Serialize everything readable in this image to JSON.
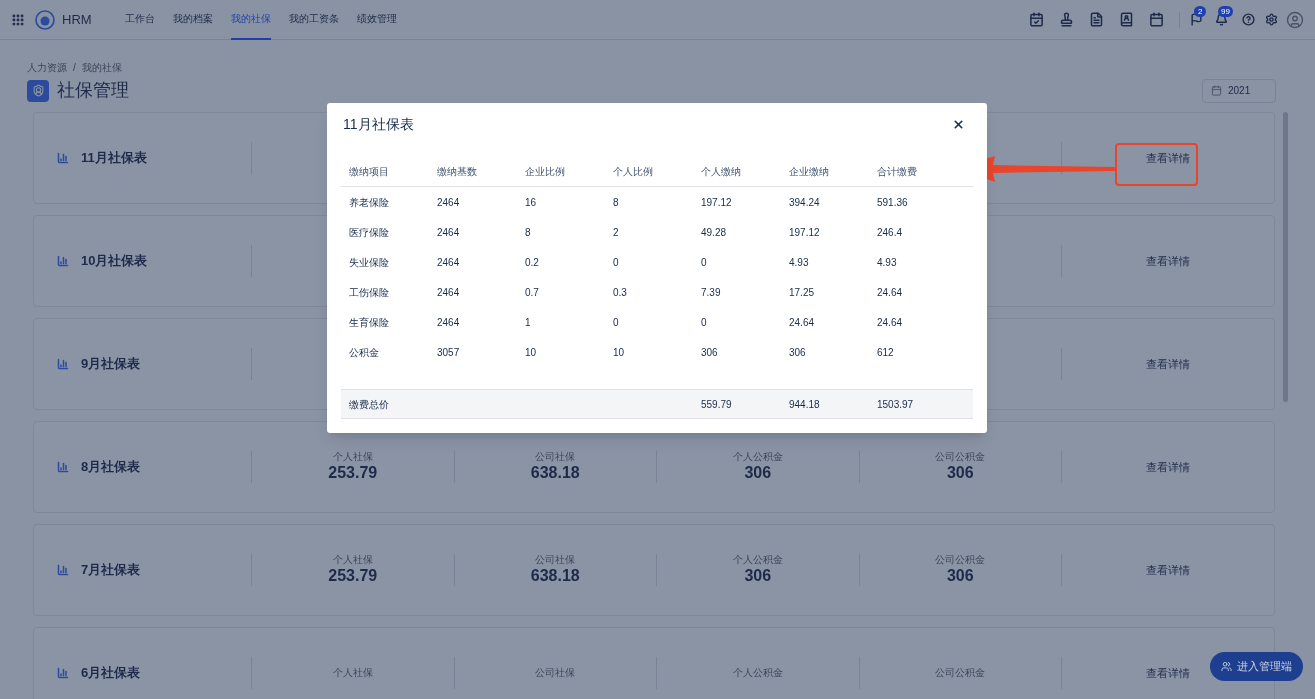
{
  "nav": {
    "app_name": "HRM",
    "tabs": [
      {
        "label": "工作台",
        "selected": false
      },
      {
        "label": "我的档案",
        "selected": false
      },
      {
        "label": "我的社保",
        "selected": true
      },
      {
        "label": "我的工资条",
        "selected": false
      },
      {
        "label": "绩效管理",
        "selected": false
      }
    ],
    "flag_badge": "2",
    "bell_badge": "99"
  },
  "breadcrumb": [
    "人力资源",
    "我的社保"
  ],
  "breadcrumb_separator": "/",
  "page_title": "社保管理",
  "year": "2021",
  "cards": [
    {
      "title": "11月社保表",
      "action": "查看详情"
    },
    {
      "title": "10月社保表",
      "action": "查看详情"
    },
    {
      "title": "9月社保表",
      "action": "查看详情"
    },
    {
      "title": "8月社保表",
      "stats": [
        {
          "label": "个人社保",
          "value": "253.79"
        },
        {
          "label": "公司社保",
          "value": "638.18"
        },
        {
          "label": "个人公积金",
          "value": "306"
        },
        {
          "label": "公司公积金",
          "value": "306"
        }
      ],
      "action": "查看详情"
    },
    {
      "title": "7月社保表",
      "stats": [
        {
          "label": "个人社保",
          "value": "253.79"
        },
        {
          "label": "公司社保",
          "value": "638.18"
        },
        {
          "label": "个人公积金",
          "value": "306"
        },
        {
          "label": "公司公积金",
          "value": "306"
        }
      ],
      "action": "查看详情"
    },
    {
      "title": "6月社保表",
      "stats": [
        {
          "label": "个人社保"
        },
        {
          "label": "公司社保"
        },
        {
          "label": "个人公积金"
        },
        {
          "label": "公司公积金"
        }
      ],
      "action": "查看详情"
    }
  ],
  "modal": {
    "title": "11月社保表",
    "columns": [
      "缴纳项目",
      "缴纳基数",
      "企业比例",
      "个人比例",
      "个人缴纳",
      "企业缴纳",
      "合计缴费"
    ],
    "rows": [
      [
        "养老保险",
        "2464",
        "16",
        "8",
        "197.12",
        "394.24",
        "591.36"
      ],
      [
        "医疗保险",
        "2464",
        "8",
        "2",
        "49.28",
        "197.12",
        "246.4"
      ],
      [
        "失业保险",
        "2464",
        "0.2",
        "0",
        "0",
        "4.93",
        "4.93"
      ],
      [
        "工伤保险",
        "2464",
        "0.7",
        "0.3",
        "7.39",
        "17.25",
        "24.64"
      ],
      [
        "生育保险",
        "2464",
        "1",
        "0",
        "0",
        "24.64",
        "24.64"
      ],
      [
        "公积金",
        "3057",
        "10",
        "10",
        "306",
        "306",
        "612"
      ]
    ],
    "total": {
      "label": "缴费总价",
      "personal": "559.79",
      "company": "944.18",
      "sum": "1503.97"
    }
  },
  "fab": "进入管理端"
}
